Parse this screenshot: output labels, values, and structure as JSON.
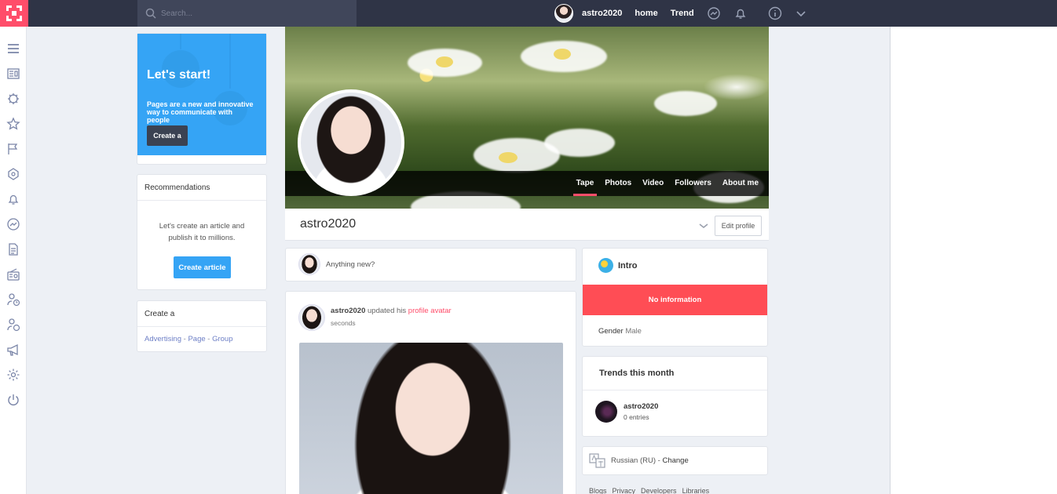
{
  "topbar": {
    "search_placeholder": "Search...",
    "username": "astro2020",
    "home_label": "home",
    "trend_label": "Trend",
    "icons": [
      "messenger-icon",
      "bell-icon",
      "info-icon",
      "chevron-down-icon"
    ]
  },
  "sidebar": {
    "icons": [
      "menu-icon",
      "news-icon",
      "puzzle-icon",
      "star-icon",
      "flag-icon",
      "cube-icon",
      "bell-icon",
      "messenger-icon",
      "document-icon",
      "radio-icon",
      "user-clock-icon",
      "user-dollar-icon",
      "megaphone-icon",
      "gear-icon",
      "power-icon"
    ]
  },
  "start_card": {
    "title": "Let's start!",
    "text": "Pages are a new and innovative way to communicate with people",
    "button": "Create a"
  },
  "recommendations": {
    "title": "Recommendations",
    "text": "Let's create an article and publish it to millions.",
    "button": "Create article"
  },
  "create_card": {
    "title": "Create a",
    "links": [
      "Advertising",
      "Page",
      "Group"
    ],
    "separator": " - "
  },
  "profile": {
    "name": "astro2020",
    "edit_button": "Edit profile",
    "tabs": [
      "Tape",
      "Photos",
      "Video",
      "Followers",
      "About me"
    ],
    "active_tab": "Tape"
  },
  "composer": {
    "placeholder": "Anything new?"
  },
  "post": {
    "author": "astro2020",
    "action": "updated his",
    "link": "profile avatar",
    "time": "seconds"
  },
  "intro": {
    "title": "Intro",
    "no_info": "No information",
    "gender_label": "Gender",
    "gender_value": "Male"
  },
  "trends": {
    "title": "Trends this month",
    "item_name": "astro2020",
    "item_count": "0 entries"
  },
  "language": {
    "current": "Russian (RU)",
    "separator": " - ",
    "change": "Change"
  },
  "footer": {
    "links": [
      "Blogs",
      "Privacy",
      "Developers",
      "Libraries"
    ]
  },
  "colors": {
    "topbar": "#2f3446",
    "accent": "#ff4d6a",
    "blue": "#35a4f5",
    "alert": "#ff4d55"
  }
}
